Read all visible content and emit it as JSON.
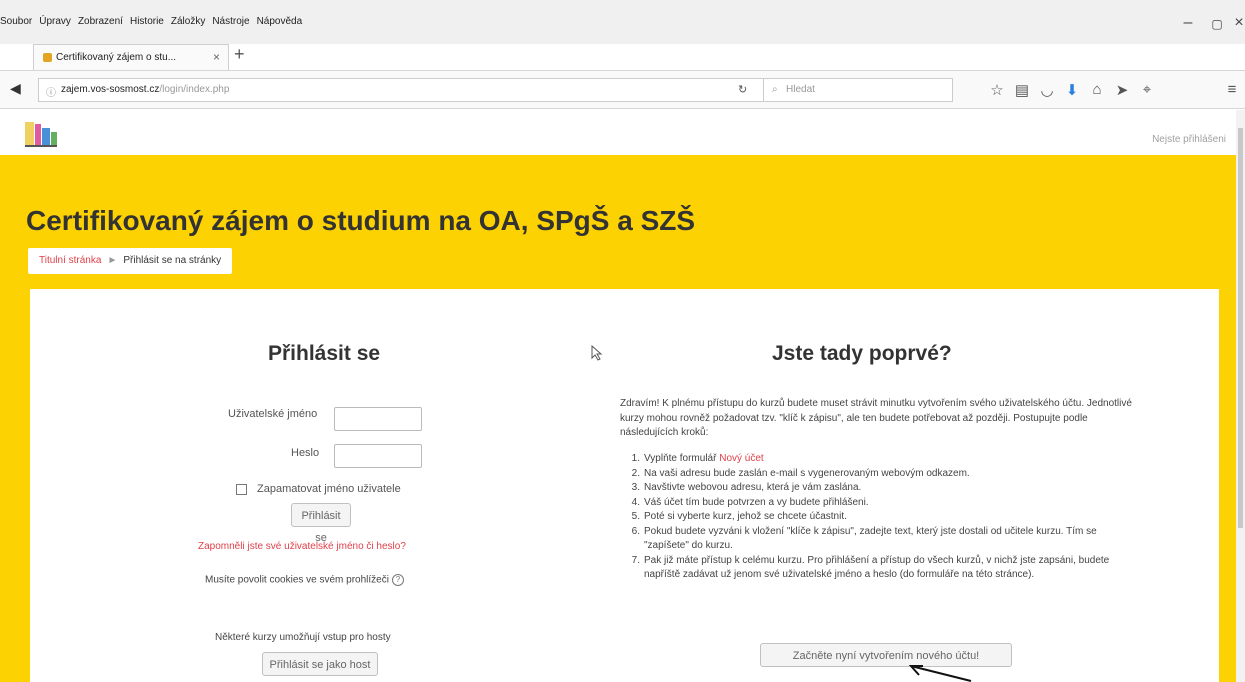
{
  "browser": {
    "menu": [
      "Soubor",
      "Úpravy",
      "Zobrazení",
      "Historie",
      "Záložky",
      "Nástroje",
      "Nápověda"
    ],
    "tab_title": "Certifikovaný zájem o stu...",
    "url_host": "zajem.vos-sosmost.cz",
    "url_path": "/login/index.php",
    "search_placeholder": "Hledat",
    "icons": [
      "star-icon",
      "reader-icon",
      "pocket-icon",
      "download-icon",
      "home-icon",
      "send-icon",
      "pin-icon",
      "menu-icon"
    ]
  },
  "site": {
    "not_logged_in": "Nejste přihlášeni",
    "title": "Certifikovaný zájem o studium na OA, SPgŠ a SZŠ",
    "breadcrumb": {
      "home": "Titulní stránka",
      "separator": "►",
      "current": "Přihlásit se na stránky"
    }
  },
  "login": {
    "heading": "Přihlásit se",
    "username_label": "Uživatelské jméno",
    "password_label": "Heslo",
    "username_value": "",
    "password_value": "",
    "remember_label": "Zapamatovat jméno uživatele",
    "submit_label": "Přihlásit se",
    "forgot_link": "Zapomněli jste své uživatelské jméno či heslo?",
    "cookies_notice": "Musíte povolit cookies ve svém prohlížeči",
    "guest_notice": "Některé kurzy umožňují vstup pro hosty",
    "guest_button": "Přihlásit se jako host"
  },
  "signup": {
    "heading": "Jste tady poprvé?",
    "intro": "Zdravím! K plnému přístupu do kurzů budete muset strávit minutku vytvořením svého uživatelského účtu. Jednotlivé kurzy mohou rovněž požadovat tzv. \"klíč k zápisu\", ale ten budete potřebovat až později. Postupujte podle následujících kroků:",
    "steps": [
      {
        "num": "1.",
        "text": "Vyplňte formulář",
        "link": "Nový účet"
      },
      {
        "num": "2.",
        "text": "Na vaši adresu bude zaslán e-mail s vygenerovaným webovým odkazem."
      },
      {
        "num": "3.",
        "text": "Navštivte webovou adresu, která je vám zaslána."
      },
      {
        "num": "4.",
        "text": "Váš účet tím bude potvrzen a vy budete přihlášeni."
      },
      {
        "num": "5.",
        "text": "Poté si vyberte kurz, jehož se chcete účastnit."
      },
      {
        "num": "6.",
        "text": "Pokud budete vyzváni k vložení \"klíče k zápisu\", zadejte text, který jste dostali od učitele kurzu. Tím se \"zapíšete\" do kurzu."
      },
      {
        "num": "7.",
        "text": "Pak již máte přístup k celému kurzu. Pro přihlášení a přístup do všech kurzů, v nichž jste zapsáni, budete napříště zadávat už jenom své uživatelské jméno a heslo (do formuláře na této stránce)."
      }
    ],
    "create_button": "Začněte nyní vytvořením nového účtu!"
  }
}
